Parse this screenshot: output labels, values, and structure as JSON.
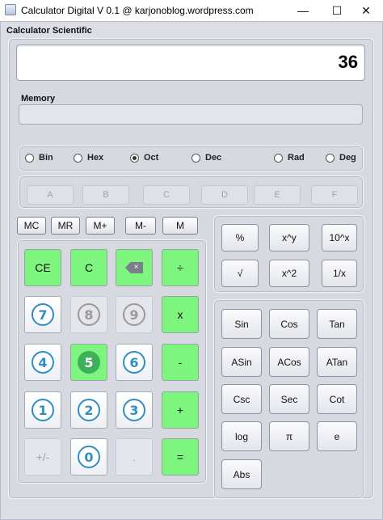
{
  "window": {
    "title": "Calculator Digital V 0.1 @ karjonoblog.wordpress.com",
    "minimize": "—",
    "maximize": "☐",
    "close": "✕"
  },
  "section_title": "Calculator Scientific",
  "display_value": "36",
  "memory_label": "Memory",
  "radios": {
    "bin": "Bin",
    "hex": "Hex",
    "oct": "Oct",
    "dec": "Dec",
    "rad": "Rad",
    "deg": "Deg",
    "selected": "Oct"
  },
  "hex_keys": [
    "A",
    "B",
    "C",
    "D",
    "E",
    "F"
  ],
  "memory_keys": [
    "MC",
    "MR",
    "M+",
    "M-",
    "M"
  ],
  "keypad": {
    "ce": "CE",
    "c": "C",
    "backspace": "×",
    "divide": "÷",
    "multiply": "x",
    "minus": "-",
    "plus": "+",
    "equals": "=",
    "plusminus": "+/-",
    "dot": ".",
    "digits": {
      "d0": "0",
      "d1": "1",
      "d2": "2",
      "d3": "3",
      "d4": "4",
      "d5": "5",
      "d6": "6",
      "d7": "7",
      "d8": "8",
      "d9": "9"
    }
  },
  "power_keys": [
    "%",
    "x^y",
    "10^x",
    "√",
    "x^2",
    "1/x"
  ],
  "trig_keys": [
    "Sin",
    "Cos",
    "Tan",
    "ASin",
    "ACos",
    "ATan",
    "Csc",
    "Sec",
    "Cot",
    "log",
    "π",
    "e",
    "Abs"
  ],
  "colors": {
    "green_key": "#7ef57e",
    "digit_blue": "#2f8fc4",
    "digit_disabled": "#9a9a9a",
    "digit_active": "#3fb05a"
  }
}
